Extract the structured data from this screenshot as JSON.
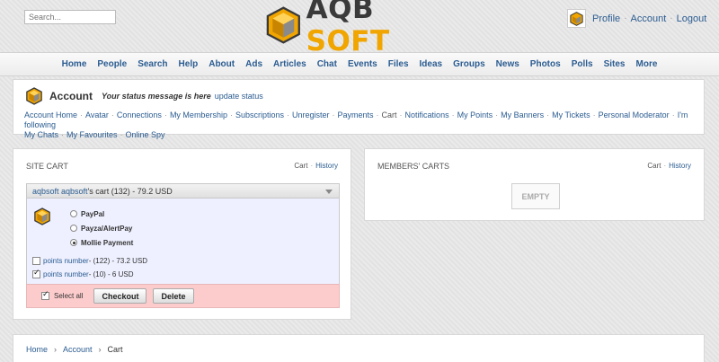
{
  "header": {
    "search_placeholder": "Search...",
    "logo_text_left": "AQB",
    "logo_text_right": "SOFT",
    "user_links": [
      "Profile",
      "Account",
      "Logout"
    ]
  },
  "main_nav": [
    "Home",
    "People",
    "Search",
    "Help",
    "About",
    "Ads",
    "Articles",
    "Chat",
    "Events",
    "Files",
    "Ideas",
    "Groups",
    "News",
    "Photos",
    "Polls",
    "Sites",
    "More"
  ],
  "account": {
    "title": "Account",
    "status_message": "Your status message is here",
    "update_status": "update status",
    "links": [
      "Account Home",
      "Avatar",
      "Connections",
      "My Membership",
      "Subscriptions",
      "Unregister",
      "Payments",
      "Cart",
      "Notifications",
      "My Points",
      "My Banners",
      "My Tickets",
      "Personal Moderator",
      "I'm following",
      "My Chats",
      "My Favourites",
      "Online Spy"
    ],
    "current_link": "Cart"
  },
  "site_cart": {
    "title": "SITE CART",
    "tab_cart": "Cart",
    "tab_history": "History",
    "cart_owner_link": "aqbsoft aqbsoft",
    "cart_summary": "'s cart (132) - 79.2 USD",
    "payment_options": [
      {
        "label": "PayPal",
        "checked": false
      },
      {
        "label": "Payza/AlertPay",
        "checked": false
      },
      {
        "label": "Mollie Payment",
        "checked": true
      }
    ],
    "items": [
      {
        "link": "points number",
        "detail": " - (122) - 73.2 USD",
        "checked": false
      },
      {
        "link": "points number",
        "detail": " - (10) - 6 USD",
        "checked": true
      }
    ],
    "select_all": "Select all",
    "checkout": "Checkout",
    "delete": "Delete"
  },
  "members_carts": {
    "title": "MEMBERS' CARTS",
    "tab_cart": "Cart",
    "tab_history": "History",
    "empty": "EMPTY"
  },
  "breadcrumb": {
    "items": [
      "Home",
      "Account"
    ],
    "current": "Cart",
    "separator": "›"
  }
}
